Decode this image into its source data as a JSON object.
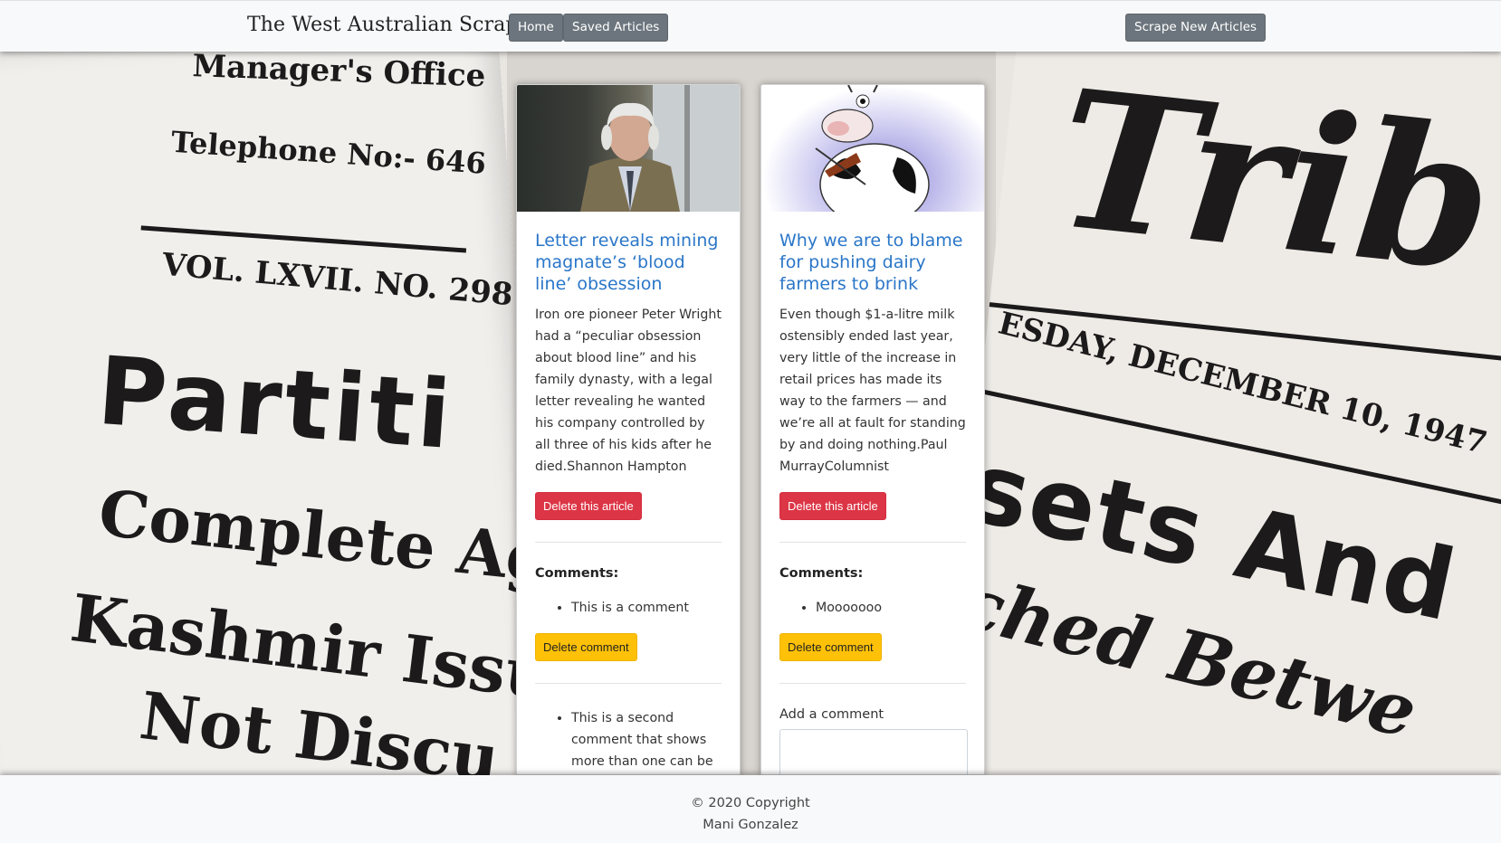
{
  "navbar": {
    "brand": "The West Australian Scraper",
    "home_label": "Home",
    "saved_label": "Saved Articles",
    "scrape_label": "Scrape New Articles"
  },
  "background": {
    "texts": [
      "Manager's Office",
      "Telephone No:- 646",
      "VOL. LXVII. NO. 298",
      "Partiti",
      "Complete Ag",
      "Kashmir Issu",
      "Not Discu",
      "Trib",
      "ESDAY, DECEMBER 10, 1947",
      "sets And",
      "ched Betwe"
    ]
  },
  "articles": [
    {
      "title": "Letter reveals mining magnate’s ‘blood line’ obsession",
      "summary": "Iron ore pioneer Peter Wright had a “peculiar obsession about blood line” and his family dynasty, with a legal letter revealing he wanted his company controlled by all three of his kids after he died.Shannon Hampton",
      "delete_label": "Delete this article",
      "comments_label": "Comments:",
      "comments": [
        {
          "text": "This is a comment",
          "delete_label": "Delete comment"
        },
        {
          "text": "This is a second comment that shows more than one can be"
        }
      ]
    },
    {
      "title": "Why we are to blame for pushing dairy farmers to brink",
      "summary": "Even though $1-a-litre milk ostensibly ended last year, very little of the increase in retail prices has made its way to the farmers — and we’re all at fault for standing by and doing nothing.Paul MurrayColumnist",
      "delete_label": "Delete this article",
      "comments_label": "Comments:",
      "comments": [
        {
          "text": "Mooooooo",
          "delete_label": "Delete comment"
        }
      ],
      "add_comment_label": "Add a comment",
      "add_comment_value": ""
    }
  ],
  "footer": {
    "copyright": "© 2020 Copyright",
    "author": "Mani Gonzalez"
  }
}
